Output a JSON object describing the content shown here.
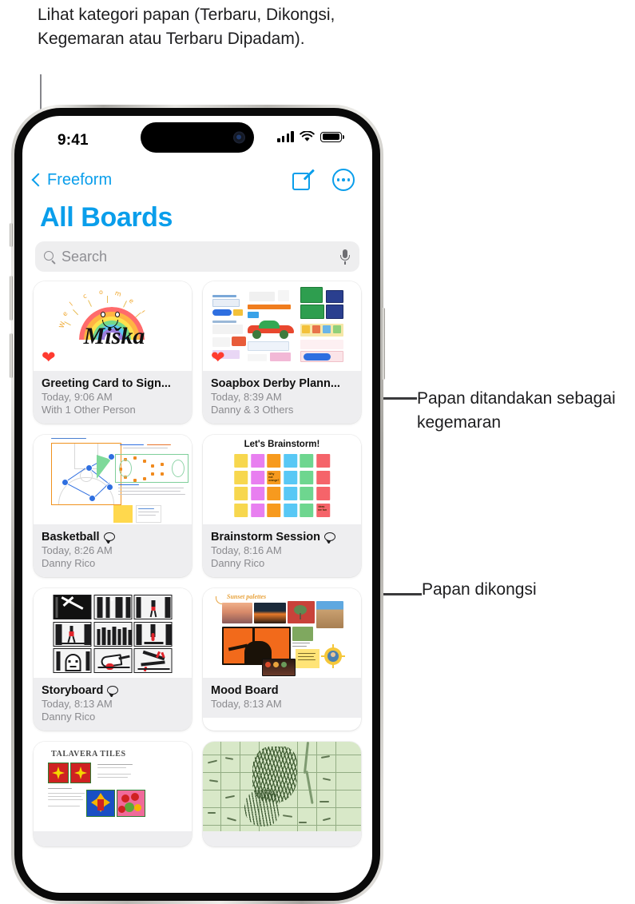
{
  "annotations": {
    "top": "Lihat kategori papan (Terbaru, Dikongsi, Kegemaran atau Terbaru Dipadam).",
    "favorite": "Papan ditandakan sebagai kegemaran",
    "shared": "Papan dikongsi"
  },
  "status_bar": {
    "time": "9:41",
    "cellular_icon": "cellular-bars-icon",
    "wifi_icon": "wifi-icon",
    "battery_icon": "battery-full-icon"
  },
  "nav": {
    "back_label": "Freeform",
    "back_icon": "chevron-left-icon",
    "compose_icon": "compose-new-board-icon",
    "more_icon": "more-options-icon"
  },
  "header": {
    "title": "All Boards"
  },
  "search": {
    "placeholder": "Search",
    "search_icon": "search-icon",
    "mic_icon": "microphone-icon"
  },
  "accent_color": "#0a9eeb",
  "favorite_color": "#ff3b30",
  "boards": [
    {
      "title": "Greeting Card to Sign...",
      "time": "Today, 9:06 AM",
      "people": "With 1 Other Person",
      "favorite": true,
      "shared": false,
      "art": "greeting-card",
      "art_text": {
        "name": "Miška",
        "arc": "Welcome"
      }
    },
    {
      "title": "Soapbox Derby Plann...",
      "time": "Today, 8:39 AM",
      "people": "Danny & 3 Others",
      "favorite": true,
      "shared": false,
      "art": "soapbox-derby"
    },
    {
      "title": "Basketball",
      "time": "Today, 8:26 AM",
      "people": "Danny Rico",
      "favorite": false,
      "shared": true,
      "art": "basketball-play-diagram"
    },
    {
      "title": "Brainstorm Session",
      "time": "Today, 8:16 AM",
      "people": "Danny Rico",
      "favorite": false,
      "shared": true,
      "art": "brainstorm-sticky-grid",
      "art_text": {
        "heading": "Let's Brainstorm!"
      }
    },
    {
      "title": "Storyboard",
      "time": "Today, 8:13 AM",
      "people": "Danny Rico",
      "favorite": false,
      "shared": true,
      "art": "storyboard-sketches"
    },
    {
      "title": "Mood Board",
      "time": "Today, 8:13 AM",
      "people": "",
      "favorite": false,
      "shared": false,
      "art": "mood-board-collage",
      "art_text": {
        "label": "Sunset palettes"
      }
    },
    {
      "title": "",
      "time": "",
      "people": "",
      "favorite": false,
      "shared": false,
      "art": "talavera-tiles",
      "art_text": {
        "heading": "TALAVERA TILES"
      }
    },
    {
      "title": "",
      "time": "",
      "people": "",
      "favorite": false,
      "shared": false,
      "art": "hex-terrain-map"
    }
  ]
}
